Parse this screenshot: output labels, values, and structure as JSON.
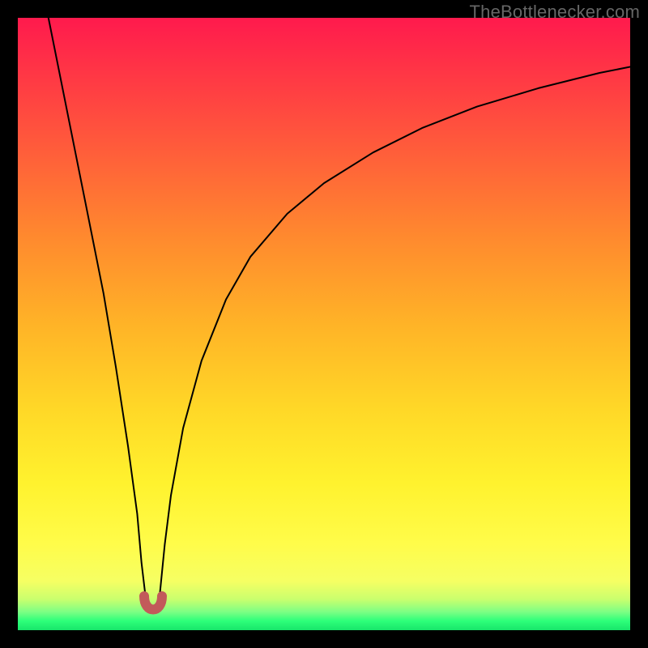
{
  "watermark": "TheBottlenecker.com",
  "chart_data": {
    "type": "line",
    "title": "",
    "xlabel": "",
    "ylabel": "",
    "xlim": [
      0,
      100
    ],
    "ylim": [
      0,
      100
    ],
    "grid": false,
    "legend": false,
    "series": [
      {
        "name": "bottleneck-curve",
        "x": [
          5,
          8,
          11,
          14,
          16,
          18,
          19.5,
          20.2,
          20.8,
          21.2,
          21.6,
          22,
          22.4,
          22.8,
          23.2,
          23.6,
          24,
          25,
          27,
          30,
          34,
          38,
          44,
          50,
          58,
          66,
          75,
          85,
          95,
          100
        ],
        "values": [
          100,
          85,
          70,
          55,
          43,
          30,
          19,
          11,
          6,
          4,
          3.4,
          3.2,
          3.4,
          4,
          6,
          10,
          14,
          22,
          33,
          44,
          54,
          61,
          68,
          73,
          78,
          82,
          85.5,
          88.5,
          91,
          92
        ]
      }
    ],
    "background_gradient": {
      "direction": "top-to-bottom",
      "stops": [
        {
          "pct": 0,
          "color": "#ff1a4d"
        },
        {
          "pct": 22,
          "color": "#ff5e3a"
        },
        {
          "pct": 50,
          "color": "#ffb327"
        },
        {
          "pct": 76,
          "color": "#fff22e"
        },
        {
          "pct": 95,
          "color": "#c8ff6e"
        },
        {
          "pct": 100,
          "color": "#18e56a"
        }
      ]
    },
    "marker": {
      "name": "u-shaped-minimum-marker",
      "color": "#c25a5a",
      "approx_x_range": [
        20.5,
        23.0
      ],
      "approx_y": 3.2
    }
  }
}
